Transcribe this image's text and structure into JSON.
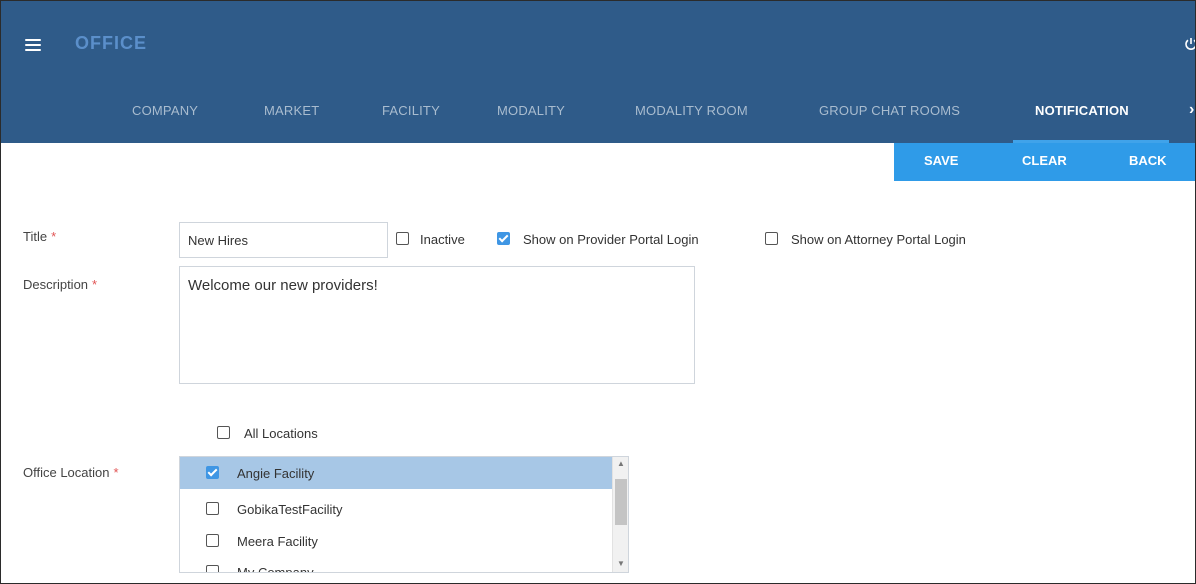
{
  "header": {
    "app_title": "OFFICE",
    "power_icon": "power-icon",
    "menu_icon": "hamburger-icon",
    "background": "#2f5b89"
  },
  "tabs": [
    {
      "label": "COMPANY",
      "active": false
    },
    {
      "label": "MARKET",
      "active": false
    },
    {
      "label": "FACILITY",
      "active": false
    },
    {
      "label": "MODALITY",
      "active": false
    },
    {
      "label": "MODALITY ROOM",
      "active": false
    },
    {
      "label": "GROUP CHAT ROOMS",
      "active": false
    },
    {
      "label": "NOTIFICATION",
      "active": true
    }
  ],
  "actions": {
    "save": "SAVE",
    "clear": "CLEAR",
    "back": "BACK",
    "color": "#2f9be8"
  },
  "form": {
    "title_label": "Title",
    "title_value": "New Hires",
    "description_label": "Description",
    "description_value": "Welcome our new providers!",
    "required_mark": "*",
    "inactive": {
      "label": "Inactive",
      "checked": false
    },
    "provider_portal": {
      "label": "Show on Provider Portal Login",
      "checked": true
    },
    "attorney_portal": {
      "label": "Show on Attorney Portal Login",
      "checked": false
    },
    "all_locations": {
      "label": "All Locations",
      "checked": false
    },
    "office_location_label": "Office Location",
    "locations": [
      {
        "label": "Angie Facility",
        "checked": true,
        "selected": true
      },
      {
        "label": "GobikaTestFacility",
        "checked": false,
        "selected": false
      },
      {
        "label": "Meera Facility",
        "checked": false,
        "selected": false
      },
      {
        "label": "My Company",
        "checked": false,
        "selected": false
      }
    ]
  }
}
